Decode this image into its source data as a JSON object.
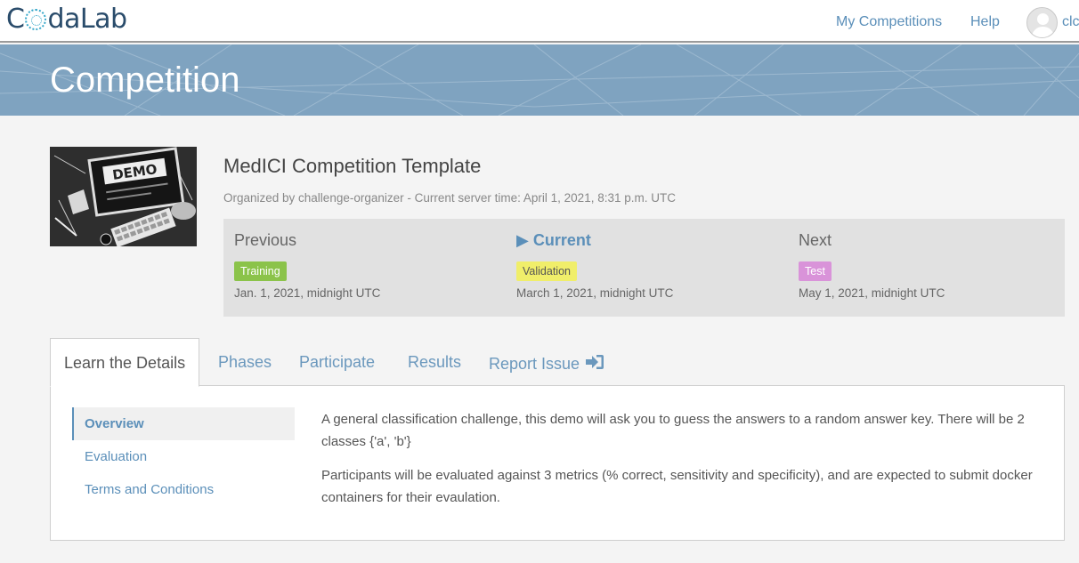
{
  "brand": {
    "logo_prefix": "C",
    "logo_suffix": "daLab"
  },
  "nav": {
    "my_competitions": "My Competitions",
    "help": "Help",
    "user": "clc"
  },
  "banner": {
    "title": "Competition"
  },
  "competition": {
    "title": "MedICI Competition Template",
    "organized_by": "Organized by challenge-organizer - Current server time: April 1, 2021, 8:31 p.m. UTC",
    "image_caption": "DEMO"
  },
  "phases": {
    "previous": {
      "label": "Previous",
      "name": "Training",
      "date": "Jan. 1, 2021, midnight UTC",
      "color": "#8bc34a"
    },
    "current": {
      "label": "Current",
      "marker": "▶",
      "name": "Validation",
      "date": "March 1, 2021, midnight UTC",
      "color": "#f0ee6a"
    },
    "next": {
      "label": "Next",
      "name": "Test",
      "date": "May 1, 2021, midnight UTC",
      "color": "#d993d9"
    }
  },
  "tabs": [
    {
      "label": "Learn the Details",
      "active": true
    },
    {
      "label": "Phases"
    },
    {
      "label": "Participate"
    },
    {
      "label": "Results"
    },
    {
      "label": "Report Issue",
      "icon": "sign-in-icon"
    }
  ],
  "side_nav": [
    {
      "label": "Overview",
      "active": true
    },
    {
      "label": "Evaluation"
    },
    {
      "label": "Terms and Conditions"
    }
  ],
  "overview": {
    "paragraphs": [
      "A general classification challenge, this demo will ask you to guess the answers to a random answer key. There will be 2 classes {'a', 'b'}",
      "Participants will be evaluated against 3 metrics (% correct, sensitivity and specificity), and are expected to submit docker containers for their evaulation."
    ]
  },
  "colors": {
    "accent": "#5b8fb9",
    "banner": "#7fa3c0",
    "brand_text": "#2a4c6b"
  }
}
